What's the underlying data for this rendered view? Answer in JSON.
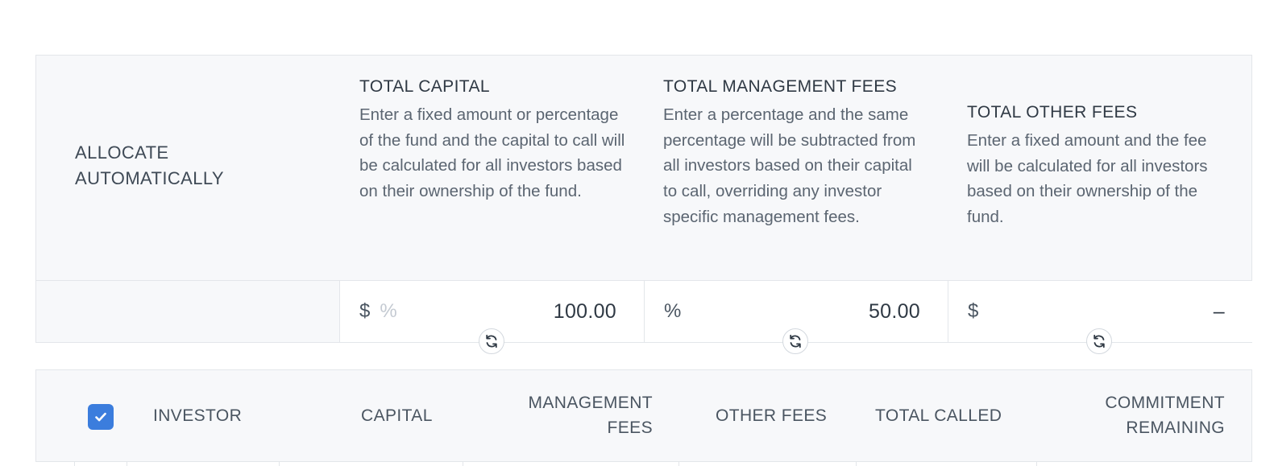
{
  "allocate": {
    "label": "ALLOCATE AUTOMATICALLY",
    "columns": [
      {
        "title": "TOTAL CAPITAL",
        "description": "Enter a fixed amount or percentage of the fund and the capital to call will be calculated for all investors based on their ownership of the fund.",
        "unit_primary": "$",
        "unit_secondary": "%",
        "value": "100.00"
      },
      {
        "title": "TOTAL MANAGEMENT FEES",
        "description": "Enter a percentage and the same percentage will be subtracted from all investors based on their capital to call, overriding any investor specific management fees.",
        "unit_primary": "%",
        "value": "50.00"
      },
      {
        "title": "TOTAL OTHER FEES",
        "description": "Enter a fixed amount and the fee will be calculated for all investors based on their ownership of the fund.",
        "unit_primary": "$",
        "value": "–"
      }
    ],
    "refresh_icon": "refresh-icon"
  },
  "table": {
    "select_all_checked": true,
    "headers": {
      "investor": "INVESTOR",
      "capital": "CAPITAL",
      "management_fees_1": "MANAGEMENT",
      "management_fees_2": "FEES",
      "other_fees": "OTHER FEES",
      "total_called": "TOTAL CALLED",
      "commitment_remaining_1": "COMMITMENT",
      "commitment_remaining_2": "REMAINING"
    }
  },
  "colors": {
    "panel_bg": "#f7f8fa",
    "border": "#e3e6ea",
    "accent": "#3b7ddd",
    "text": "#3f4a56"
  }
}
